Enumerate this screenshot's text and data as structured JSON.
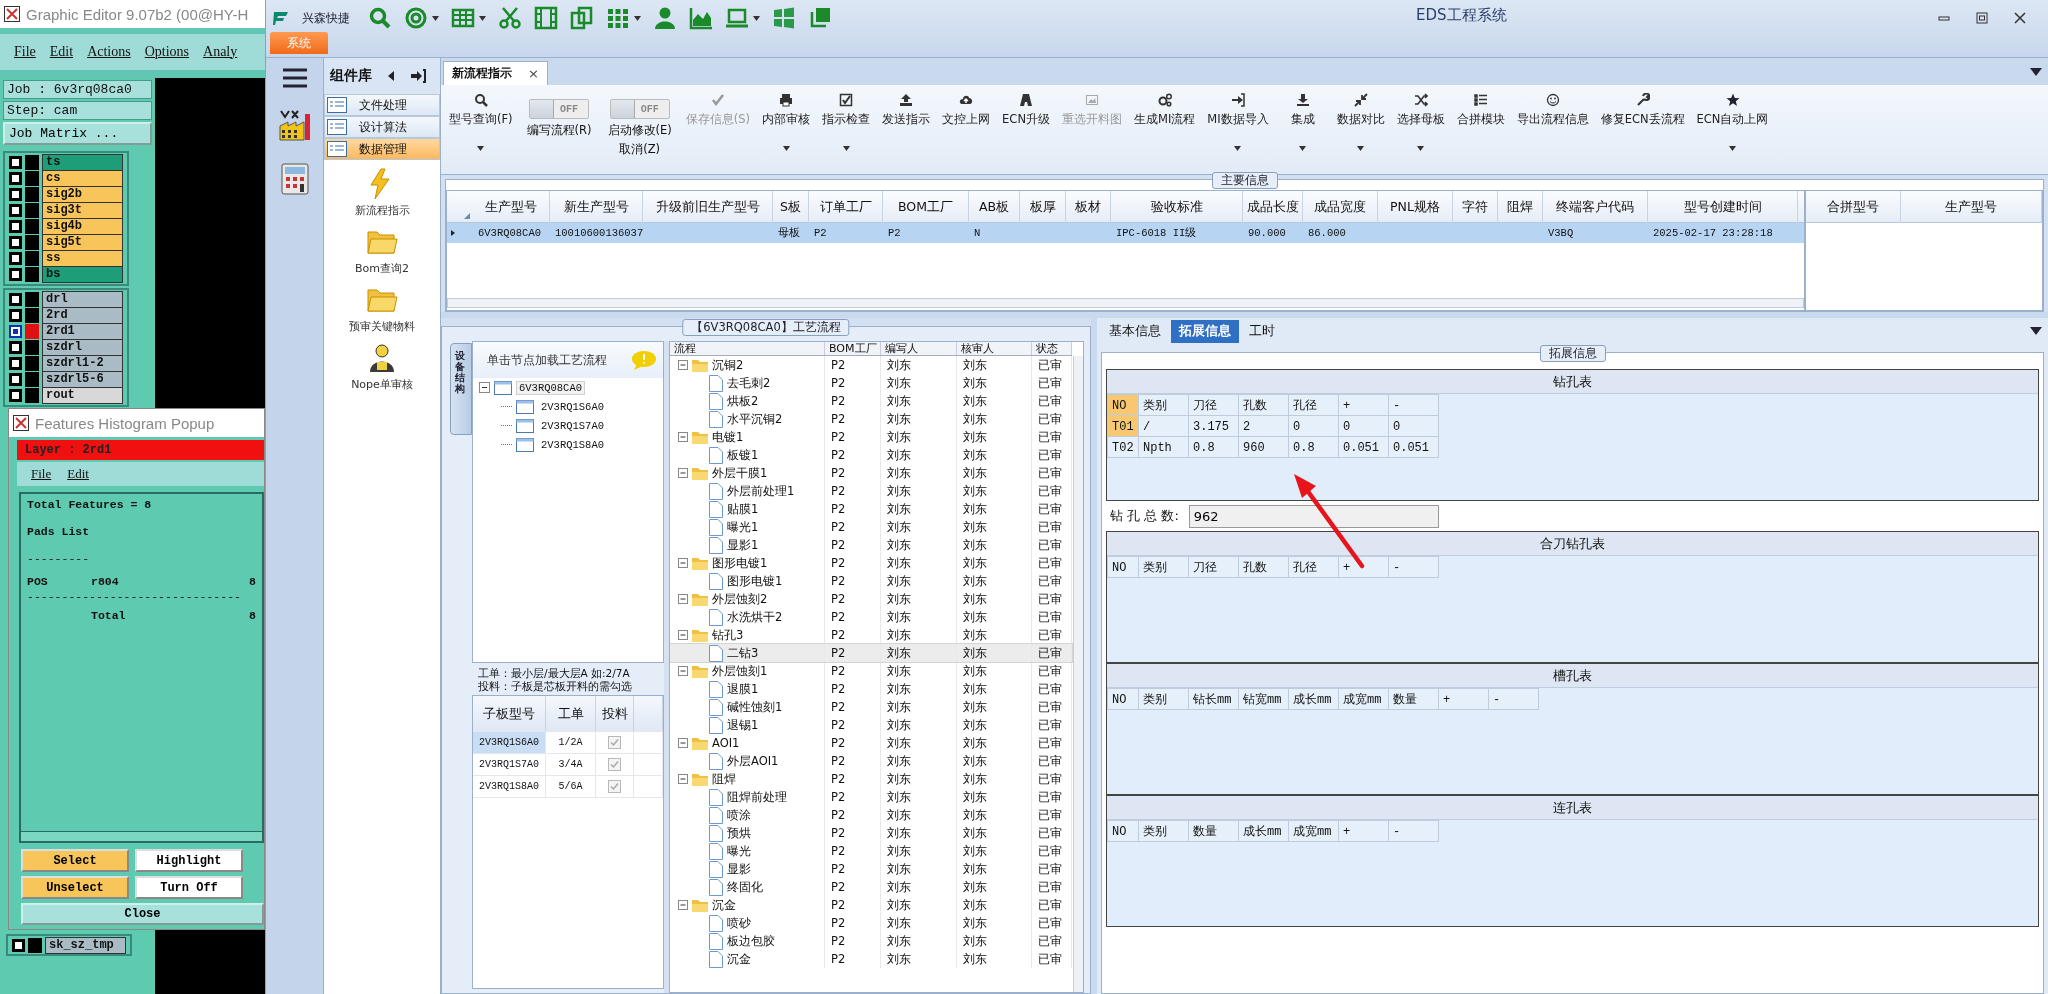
{
  "graphic_editor": {
    "title": "Graphic Editor 9.07b2 (00@HY-H",
    "menu": [
      "File",
      "Edit",
      "Actions",
      "Options",
      "Analy"
    ],
    "job": "Job : 6v3rq08ca0",
    "step": "Step: cam",
    "matrix_button": "Job Matrix ...",
    "layer_groups": [
      {
        "layers": [
          {
            "name": "ts",
            "color": "#1e9e78",
            "selected": false
          },
          {
            "name": "cs",
            "color": "#f7c55a",
            "selected": false
          },
          {
            "name": "sig2b",
            "color": "#f7c55a",
            "selected": false
          },
          {
            "name": "sig3t",
            "color": "#f7c55a",
            "selected": false
          },
          {
            "name": "sig4b",
            "color": "#f7c55a",
            "selected": false
          },
          {
            "name": "sig5t",
            "color": "#f7c55a",
            "selected": false
          },
          {
            "name": "ss",
            "color": "#f7c55a",
            "selected": false
          },
          {
            "name": "bs",
            "color": "#1e9e78",
            "selected": false
          }
        ]
      },
      {
        "layers": [
          {
            "name": "drl",
            "color": "#a9bcc6",
            "selected": false
          },
          {
            "name": "2rd",
            "color": "#a9bcc6",
            "selected": false
          },
          {
            "name": "2rd1",
            "color": "#a9bcc6",
            "selected": true
          },
          {
            "name": "szdrl",
            "color": "#a9bcc6",
            "selected": false
          },
          {
            "name": "szdrl1-2",
            "color": "#a9bcc6",
            "selected": false
          },
          {
            "name": "szdrl5-6",
            "color": "#a9bcc6",
            "selected": false
          },
          {
            "name": "rout",
            "color": "#d8d8d8",
            "selected": false
          }
        ]
      }
    ],
    "bottom_layer": {
      "name": "sk_sz_tmp",
      "color": "#a9bcc6",
      "selected": false
    }
  },
  "popup": {
    "title": "Features Histogram Popup",
    "layer": "Layer :  2rd1",
    "menu": [
      "File",
      "Edit"
    ],
    "report": [
      {
        "kind": "text",
        "text": "Total Features = 8"
      },
      {
        "kind": "text",
        "text": "Pads List"
      },
      {
        "kind": "rule",
        "text": "---------"
      },
      {
        "kind": "row",
        "cells": [
          "POS",
          "r804",
          "8"
        ]
      },
      {
        "kind": "rule",
        "text": "-------------------------------"
      },
      {
        "kind": "total",
        "cells": [
          "Total",
          "8"
        ]
      }
    ],
    "buttons": [
      {
        "label": "Select",
        "kind": "action"
      },
      {
        "label": "Highlight",
        "kind": "mode"
      },
      {
        "label": "Unselect",
        "kind": "action"
      },
      {
        "label": "Turn Off",
        "kind": "mode"
      }
    ],
    "close": "Close"
  },
  "eds": {
    "brand": "兴森快捷",
    "title": "EDS工程系统",
    "ribbon_tab": "系统",
    "component_library": {
      "title": "组件库",
      "categories": [
        {
          "label": "文件处理",
          "selected": false
        },
        {
          "label": "设计算法",
          "selected": false
        },
        {
          "label": "数据管理",
          "selected": true
        }
      ],
      "tools": [
        {
          "label": "新流程指示",
          "kind": "lightning"
        },
        {
          "label": "Bom查询2",
          "kind": "folder"
        },
        {
          "label": "预审关键物料",
          "kind": "folder"
        },
        {
          "label": "Nope单审核",
          "kind": "user"
        }
      ]
    },
    "document_tab": {
      "label": "新流程指示",
      "close": "×"
    },
    "toolbar": [
      {
        "kind": "button",
        "label": "型号查询(F)",
        "disabled": false,
        "dropdown": true
      },
      {
        "kind": "toggle",
        "toggle_text": "OFF",
        "on": false,
        "label": "编写流程(R)"
      },
      {
        "kind": "toggle",
        "toggle_text": "OFF",
        "on": false,
        "label": "启动修改(E)",
        "sublabel": "取消(Z)"
      },
      {
        "kind": "button",
        "label": "保存信息(S)",
        "disabled": true,
        "dropdown": false
      },
      {
        "kind": "button",
        "label": "内部审核",
        "disabled": false,
        "dropdown": true
      },
      {
        "kind": "button",
        "label": "指示检查",
        "disabled": false,
        "dropdown": true
      },
      {
        "kind": "button",
        "label": "发送指示",
        "disabled": false,
        "dropdown": false
      },
      {
        "kind": "button",
        "label": "文控上网",
        "disabled": false,
        "dropdown": false
      },
      {
        "kind": "button",
        "label": "ECN升级",
        "disabled": false,
        "dropdown": false
      },
      {
        "kind": "button",
        "label": "重选开料图",
        "disabled": true,
        "dropdown": false
      },
      {
        "kind": "button",
        "label": "生成MI流程",
        "disabled": false,
        "dropdown": false
      },
      {
        "kind": "button",
        "label": "MI数据导入",
        "disabled": false,
        "dropdown": true
      },
      {
        "kind": "button",
        "label": "集成",
        "disabled": false,
        "dropdown": true
      },
      {
        "kind": "button",
        "label": "数据对比",
        "disabled": false,
        "dropdown": true
      },
      {
        "kind": "button",
        "label": "选择母板",
        "disabled": false,
        "dropdown": true
      },
      {
        "kind": "button",
        "label": "合拼模块",
        "disabled": false,
        "dropdown": false
      },
      {
        "kind": "button",
        "label": "导出流程信息",
        "disabled": false,
        "dropdown": false
      },
      {
        "kind": "button",
        "label": "修复ECN丢流程",
        "disabled": false,
        "dropdown": false
      },
      {
        "kind": "button",
        "label": "ECN自动上网",
        "disabled": false,
        "dropdown": true
      }
    ],
    "main_info": {
      "title": "主要信息",
      "columns": [
        "生产型号",
        "新生产型号",
        "升级前旧生产型号",
        "S板",
        "订单工厂",
        "BOM工厂",
        "AB板",
        "板厚",
        "板材",
        "验收标准",
        "成品长度",
        "成品宽度",
        "PNL规格",
        "字符",
        "阻焊",
        "终端客户代码",
        "型号创建时间"
      ],
      "rows": [
        {
          "selected": true,
          "cells": [
            "6V3RQ08CA0",
            "10010600136037",
            null,
            "母板",
            "P2",
            "P2",
            "N",
            null,
            null,
            "IPC-6018 II级",
            "90.000",
            "86.000",
            null,
            null,
            null,
            "V3BQ",
            "2025-02-17 23:28:18"
          ]
        }
      ],
      "side_columns": [
        "合拼型号",
        "生产型号"
      ]
    },
    "flow_panel": {
      "title": "【6V3RQ08CA0】工艺流程",
      "side_tab": "设备结构",
      "hint": "单击节点加载工艺流程",
      "tree": [
        {
          "label": "6V3RQ08CA0",
          "expanded": true,
          "selected": true,
          "children": [
            {
              "label": "2V3RQ1S6A0",
              "selected": false
            },
            {
              "label": "2V3RQ1S7A0",
              "selected": false
            },
            {
              "label": "2V3RQ1S8A0",
              "selected": false
            }
          ]
        }
      ],
      "notes": [
        "工单：最小层/最大层A 如:2/7A",
        "投料：子板是芯板开料的需勾选"
      ],
      "sub_table": {
        "columns": [
          "子板型号",
          "工单",
          "投料"
        ],
        "rows": [
          {
            "model": "2V3RQ1S6A0",
            "order": "1/2A",
            "feed": true,
            "selected": true
          },
          {
            "model": "2V3RQ1S7A0",
            "order": "3/4A",
            "feed": true,
            "selected": false
          },
          {
            "model": "2V3RQ1S8A0",
            "order": "5/6A",
            "feed": true,
            "selected": false
          }
        ]
      }
    },
    "flow_grid": {
      "columns": [
        "流程",
        "BOM工厂",
        "编写人",
        "核审人",
        "状态"
      ],
      "rows": [
        {
          "label": "沉铜2",
          "bom": "P2",
          "writer": "刘东",
          "reviewer": "刘东",
          "status": "已审",
          "expanded": true,
          "selected": false,
          "children": [
            {
              "label": "去毛刺2",
              "bom": "P2",
              "writer": "刘东",
              "reviewer": "刘东",
              "status": "已审",
              "selected": false
            },
            {
              "label": "烘板2",
              "bom": "P2",
              "writer": "刘东",
              "reviewer": "刘东",
              "status": "已审",
              "selected": false
            },
            {
              "label": "水平沉铜2",
              "bom": "P2",
              "writer": "刘东",
              "reviewer": "刘东",
              "status": "已审",
              "selected": false
            }
          ]
        },
        {
          "label": "电镀1",
          "bom": "P2",
          "writer": "刘东",
          "reviewer": "刘东",
          "status": "已审",
          "expanded": true,
          "selected": false,
          "children": [
            {
              "label": "板镀1",
              "bom": "P2",
              "writer": "刘东",
              "reviewer": "刘东",
              "status": "已审",
              "selected": false
            }
          ]
        },
        {
          "label": "外层干膜1",
          "bom": "P2",
          "writer": "刘东",
          "reviewer": "刘东",
          "status": "已审",
          "expanded": true,
          "selected": false,
          "children": [
            {
              "label": "外层前处理1",
              "bom": "P2",
              "writer": "刘东",
              "reviewer": "刘东",
              "status": "已审",
              "selected": false
            },
            {
              "label": "贴膜1",
              "bom": "P2",
              "writer": "刘东",
              "reviewer": "刘东",
              "status": "已审",
              "selected": false
            },
            {
              "label": "曝光1",
              "bom": "P2",
              "writer": "刘东",
              "reviewer": "刘东",
              "status": "已审",
              "selected": false
            },
            {
              "label": "显影1",
              "bom": "P2",
              "writer": "刘东",
              "reviewer": "刘东",
              "status": "已审",
              "selected": false
            }
          ]
        },
        {
          "label": "图形电镀1",
          "bom": "P2",
          "writer": "刘东",
          "reviewer": "刘东",
          "status": "已审",
          "expanded": true,
          "selected": false,
          "children": [
            {
              "label": "图形电镀1",
              "bom": "P2",
              "writer": "刘东",
              "reviewer": "刘东",
              "status": "已审",
              "selected": false
            }
          ]
        },
        {
          "label": "外层蚀刻2",
          "bom": "P2",
          "writer": "刘东",
          "reviewer": "刘东",
          "status": "已审",
          "expanded": true,
          "selected": false,
          "children": [
            {
              "label": "水洗烘干2",
              "bom": "P2",
              "writer": "刘东",
              "reviewer": "刘东",
              "status": "已审",
              "selected": false
            }
          ]
        },
        {
          "label": "钻孔3",
          "bom": "P2",
          "writer": "刘东",
          "reviewer": "刘东",
          "status": "已审",
          "expanded": true,
          "selected": false,
          "children": [
            {
              "label": "二钻3",
              "bom": "P2",
              "writer": "刘东",
              "reviewer": "刘东",
              "status": "已审",
              "selected": true
            }
          ]
        },
        {
          "label": "外层蚀刻1",
          "bom": "P2",
          "writer": "刘东",
          "reviewer": "刘东",
          "status": "已审",
          "expanded": true,
          "selected": false,
          "children": [
            {
              "label": "退膜1",
              "bom": "P2",
              "writer": "刘东",
              "reviewer": "刘东",
              "status": "已审",
              "selected": false
            },
            {
              "label": "碱性蚀刻1",
              "bom": "P2",
              "writer": "刘东",
              "reviewer": "刘东",
              "status": "已审",
              "selected": false
            },
            {
              "label": "退锡1",
              "bom": "P2",
              "writer": "刘东",
              "reviewer": "刘东",
              "status": "已审",
              "selected": false
            }
          ]
        },
        {
          "label": "AOI1",
          "bom": "P2",
          "writer": "刘东",
          "reviewer": "刘东",
          "status": "已审",
          "expanded": true,
          "selected": false,
          "children": [
            {
              "label": "外层AOI1",
              "bom": "P2",
              "writer": "刘东",
              "reviewer": "刘东",
              "status": "已审",
              "selected": false
            }
          ]
        },
        {
          "label": "阻焊",
          "bom": "P2",
          "writer": "刘东",
          "reviewer": "刘东",
          "status": "已审",
          "expanded": true,
          "selected": false,
          "children": [
            {
              "label": "阻焊前处理",
              "bom": "P2",
              "writer": "刘东",
              "reviewer": "刘东",
              "status": "已审",
              "selected": false
            },
            {
              "label": "喷涂",
              "bom": "P2",
              "writer": "刘东",
              "reviewer": "刘东",
              "status": "已审",
              "selected": false
            },
            {
              "label": "预烘",
              "bom": "P2",
              "writer": "刘东",
              "reviewer": "刘东",
              "status": "已审",
              "selected": false
            },
            {
              "label": "曝光",
              "bom": "P2",
              "writer": "刘东",
              "reviewer": "刘东",
              "status": "已审",
              "selected": false
            },
            {
              "label": "显影",
              "bom": "P2",
              "writer": "刘东",
              "reviewer": "刘东",
              "status": "已审",
              "selected": false
            },
            {
              "label": "终固化",
              "bom": "P2",
              "writer": "刘东",
              "reviewer": "刘东",
              "status": "已审",
              "selected": false
            }
          ]
        },
        {
          "label": "沉金",
          "bom": "P2",
          "writer": "刘东",
          "reviewer": "刘东",
          "status": "已审",
          "expanded": true,
          "selected": false,
          "children": [
            {
              "label": "喷砂",
              "bom": "P2",
              "writer": "刘东",
              "reviewer": "刘东",
              "status": "已审",
              "selected": false
            },
            {
              "label": "板边包胶",
              "bom": "P2",
              "writer": "刘东",
              "reviewer": "刘东",
              "status": "已审",
              "selected": false
            },
            {
              "label": "沉金",
              "bom": "P2",
              "writer": "刘东",
              "reviewer": "刘东",
              "status": "已审",
              "selected": false
            }
          ]
        }
      ]
    },
    "detail": {
      "tabs": [
        {
          "label": "基本信息",
          "selected": false
        },
        {
          "label": "拓展信息",
          "selected": true
        },
        {
          "label": "工时",
          "selected": false
        }
      ],
      "group_title": "拓展信息",
      "sections": [
        {
          "title": "钻孔表",
          "columns": [
            "NO",
            "类别",
            "刀径",
            "孔数",
            "孔径",
            "+",
            "-"
          ],
          "rows": [
            {
              "selected": true,
              "cells": [
                "T01",
                "/",
                "3.175",
                "2",
                "0",
                "0",
                "0"
              ]
            },
            {
              "selected": false,
              "cells": [
                "T02",
                "Npth",
                "0.8",
                "960",
                "0.8",
                "0.051",
                "0.051"
              ]
            }
          ],
          "total": {
            "label": "钻 孔 总 数:",
            "value": "962"
          }
        },
        {
          "title": "合刀钻孔表",
          "columns": [
            "NO",
            "类别",
            "刀径",
            "孔数",
            "孔径",
            "+",
            "-"
          ]
        },
        {
          "title": "槽孔表",
          "columns": [
            "NO",
            "类别",
            "钻长mm",
            "钻宽mm",
            "成长mm",
            "成宽mm",
            "数量",
            "+",
            "-"
          ]
        },
        {
          "title": "连孔表",
          "columns": [
            "NO",
            "类别",
            "数量",
            "成长mm",
            "成宽mm",
            "+",
            "-"
          ]
        }
      ]
    }
  }
}
